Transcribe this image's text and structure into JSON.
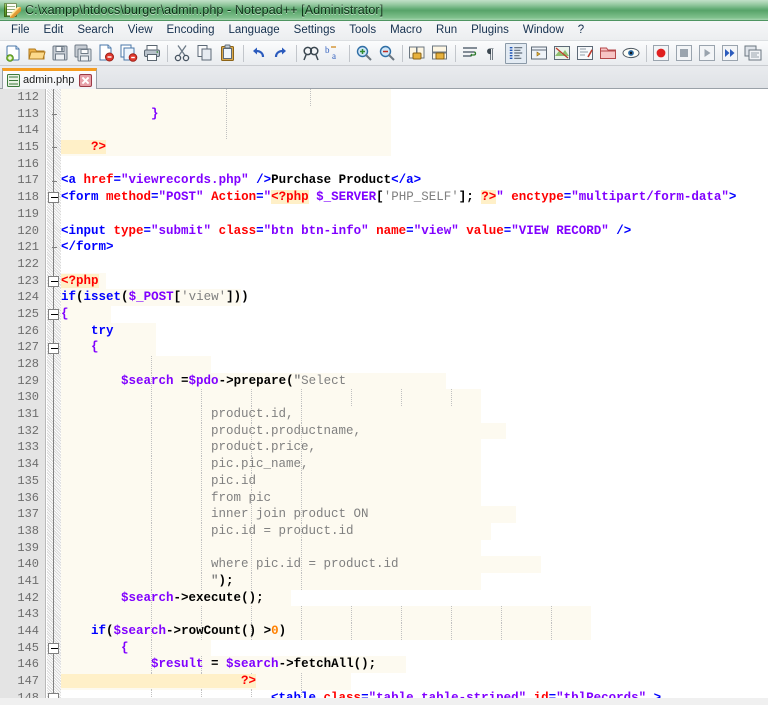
{
  "window": {
    "title": "C:\\xampp\\htdocs\\burger\\admin.php - Notepad++ [Administrator]",
    "app_icon": "notepad-plus-plus-icon"
  },
  "menubar": {
    "items": [
      {
        "label": "File"
      },
      {
        "label": "Edit"
      },
      {
        "label": "Search"
      },
      {
        "label": "View"
      },
      {
        "label": "Encoding"
      },
      {
        "label": "Language"
      },
      {
        "label": "Settings"
      },
      {
        "label": "Tools"
      },
      {
        "label": "Macro"
      },
      {
        "label": "Run"
      },
      {
        "label": "Plugins"
      },
      {
        "label": "Window"
      },
      {
        "label": "?"
      }
    ]
  },
  "toolbar": {
    "buttons": [
      {
        "name": "new-file-icon",
        "title": "New"
      },
      {
        "name": "open-file-icon",
        "title": "Open"
      },
      {
        "name": "save-icon",
        "title": "Save"
      },
      {
        "name": "save-all-icon",
        "title": "Save All"
      },
      {
        "name": "close-file-icon",
        "title": "Close"
      },
      {
        "name": "close-all-icon",
        "title": "Close All"
      },
      {
        "name": "print-icon",
        "title": "Print"
      },
      {
        "name": "separator-1",
        "title": ""
      },
      {
        "name": "cut-icon",
        "title": "Cut"
      },
      {
        "name": "copy-icon",
        "title": "Copy"
      },
      {
        "name": "paste-icon",
        "title": "Paste"
      },
      {
        "name": "separator-2",
        "title": ""
      },
      {
        "name": "undo-icon",
        "title": "Undo"
      },
      {
        "name": "redo-icon",
        "title": "Redo"
      },
      {
        "name": "separator-3",
        "title": ""
      },
      {
        "name": "find-icon",
        "title": "Find"
      },
      {
        "name": "replace-icon",
        "title": "Replace"
      },
      {
        "name": "separator-4",
        "title": ""
      },
      {
        "name": "zoom-in-icon",
        "title": "Zoom In"
      },
      {
        "name": "zoom-out-icon",
        "title": "Zoom Out"
      },
      {
        "name": "separator-5",
        "title": ""
      },
      {
        "name": "sync-vertical-scroll-icon",
        "title": "Synchronize Vertical Scrolling"
      },
      {
        "name": "sync-horizontal-scroll-icon",
        "title": "Synchronize Horizontal Scrolling"
      },
      {
        "name": "separator-6",
        "title": ""
      },
      {
        "name": "word-wrap-icon",
        "title": "Word wrap"
      },
      {
        "name": "show-all-characters-icon",
        "title": "Show All Characters"
      },
      {
        "name": "show-indent-guide-icon",
        "title": "Show Indent Guide"
      },
      {
        "name": "user-defined-dialog-icon",
        "title": "User Defined Dialogue"
      },
      {
        "name": "document-map-icon",
        "title": "Document Map"
      },
      {
        "name": "function-list-icon",
        "title": "Function List"
      },
      {
        "name": "folder-workspace-icon",
        "title": "Folder as Workspace"
      },
      {
        "name": "monitoring-icon",
        "title": "Monitoring"
      },
      {
        "name": "separator-7",
        "title": ""
      },
      {
        "name": "record-macro-icon",
        "title": "Start Recording"
      },
      {
        "name": "stop-macro-icon",
        "title": "Stop Recording"
      },
      {
        "name": "play-macro-icon",
        "title": "Playback"
      },
      {
        "name": "run-macro-multiple-icon",
        "title": "Run a Macro Multiple Times"
      },
      {
        "name": "save-macro-icon",
        "title": "Save Current Recorded Macro"
      },
      {
        "name": "separator-8",
        "title": ""
      },
      {
        "name": "run-icon",
        "title": "Run"
      }
    ]
  },
  "tabs": [
    {
      "label": "admin.php",
      "icon": "saved-document-icon",
      "close": "close-tab-icon",
      "active": true
    }
  ],
  "editor": {
    "first_line_number": 112,
    "lines": [
      {
        "n": 112,
        "php_bg": true,
        "bg_w": 330,
        "indent_guides": [
          165,
          249
        ],
        "tokens": []
      },
      {
        "n": 113,
        "php_bg": true,
        "bg_w": 330,
        "indent_guides": [
          165
        ],
        "tokens": [
          {
            "c": "t-brace",
            "s": "            }"
          }
        ]
      },
      {
        "n": 114,
        "php_bg": true,
        "bg_w": 330,
        "indent_guides": [
          165
        ],
        "tokens": []
      },
      {
        "n": 115,
        "php_bg": true,
        "bg_w": 330,
        "indent_guides": [],
        "tokens": [
          {
            "c": "t-php",
            "s": "    ?>"
          }
        ]
      },
      {
        "n": 116,
        "php_bg": false,
        "bg_w": 0,
        "indent_guides": [],
        "tokens": []
      },
      {
        "n": 117,
        "php_bg": false,
        "bg_w": 0,
        "indent_guides": [],
        "tokens": [
          {
            "c": "t-tag",
            "s": "<a "
          },
          {
            "c": "t-attr",
            "s": "href"
          },
          {
            "c": "t-tag",
            "s": "="
          },
          {
            "c": "t-val",
            "s": "\"viewrecords.php\""
          },
          {
            "c": "t-tag",
            "s": " />"
          },
          {
            "c": "t-txt",
            "s": "Purchase Product"
          },
          {
            "c": "t-tag",
            "s": "</a>"
          }
        ]
      },
      {
        "n": 118,
        "php_bg": false,
        "bg_w": 0,
        "indent_guides": [],
        "tokens": [
          {
            "c": "t-tag",
            "s": "<form "
          },
          {
            "c": "t-attr",
            "s": "method"
          },
          {
            "c": "t-tag",
            "s": "="
          },
          {
            "c": "t-val",
            "s": "\"POST\""
          },
          {
            "c": "t-tag",
            "s": " "
          },
          {
            "c": "t-attr",
            "s": "Action"
          },
          {
            "c": "t-tag",
            "s": "="
          },
          {
            "c": "t-val",
            "s": "\""
          },
          {
            "c": "t-php",
            "s": "<?php"
          },
          {
            "c": "t-op",
            "s": " "
          },
          {
            "c": "t-var",
            "s": "$_SERVER"
          },
          {
            "c": "t-op",
            "s": "["
          },
          {
            "c": "t-str",
            "s": "'PHP_SELF'"
          },
          {
            "c": "t-op",
            "s": "]; "
          },
          {
            "c": "t-php",
            "s": "?>"
          },
          {
            "c": "t-val",
            "s": "\""
          },
          {
            "c": "t-tag",
            "s": " "
          },
          {
            "c": "t-attr",
            "s": "enctype"
          },
          {
            "c": "t-tag",
            "s": "="
          },
          {
            "c": "t-val",
            "s": "\"multipart/form-data\""
          },
          {
            "c": "t-tag",
            "s": ">"
          }
        ]
      },
      {
        "n": 119,
        "php_bg": false,
        "bg_w": 0,
        "indent_guides": [],
        "tokens": []
      },
      {
        "n": 120,
        "php_bg": false,
        "bg_w": 0,
        "indent_guides": [],
        "tokens": [
          {
            "c": "t-tag",
            "s": "<input "
          },
          {
            "c": "t-attr",
            "s": "type"
          },
          {
            "c": "t-tag",
            "s": "="
          },
          {
            "c": "t-val",
            "s": "\"submit\""
          },
          {
            "c": "t-tag",
            "s": " "
          },
          {
            "c": "t-attr",
            "s": "class"
          },
          {
            "c": "t-tag",
            "s": "="
          },
          {
            "c": "t-val",
            "s": "\"btn btn-info\""
          },
          {
            "c": "t-tag",
            "s": " "
          },
          {
            "c": "t-attr",
            "s": "name"
          },
          {
            "c": "t-tag",
            "s": "="
          },
          {
            "c": "t-val",
            "s": "\"view\""
          },
          {
            "c": "t-tag",
            "s": " "
          },
          {
            "c": "t-attr",
            "s": "value"
          },
          {
            "c": "t-tag",
            "s": "="
          },
          {
            "c": "t-val",
            "s": "\"VIEW RECORD\""
          },
          {
            "c": "t-tag",
            "s": " />"
          }
        ]
      },
      {
        "n": 121,
        "php_bg": false,
        "bg_w": 0,
        "indent_guides": [],
        "tokens": [
          {
            "c": "t-tag",
            "s": "</form>"
          }
        ]
      },
      {
        "n": 122,
        "php_bg": false,
        "bg_w": 0,
        "indent_guides": [],
        "tokens": []
      },
      {
        "n": 123,
        "php_bg": true,
        "bg_w": 45,
        "indent_guides": [],
        "tokens": [
          {
            "c": "t-php",
            "s": "<?php"
          }
        ]
      },
      {
        "n": 124,
        "php_bg": true,
        "bg_w": 180,
        "indent_guides": [],
        "tokens": [
          {
            "c": "t-kw",
            "s": "if"
          },
          {
            "c": "t-op",
            "s": "("
          },
          {
            "c": "t-kw",
            "s": "isset"
          },
          {
            "c": "t-op",
            "s": "("
          },
          {
            "c": "t-var",
            "s": "$_POST"
          },
          {
            "c": "t-op",
            "s": "["
          },
          {
            "c": "t-str",
            "s": "'view'"
          },
          {
            "c": "t-op",
            "s": "]))"
          }
        ]
      },
      {
        "n": 125,
        "php_bg": true,
        "bg_w": 50,
        "indent_guides": [],
        "tokens": [
          {
            "c": "t-brace",
            "s": "{"
          }
        ]
      },
      {
        "n": 126,
        "php_bg": true,
        "bg_w": 95,
        "indent_guides": [],
        "tokens": [
          {
            "c": "t-kw",
            "s": "    try"
          }
        ]
      },
      {
        "n": 127,
        "php_bg": true,
        "bg_w": 95,
        "indent_guides": [],
        "tokens": [
          {
            "c": "t-brace",
            "s": "    {"
          }
        ]
      },
      {
        "n": 128,
        "php_bg": true,
        "bg_w": 150,
        "indent_guides": [
          90
        ],
        "tokens": []
      },
      {
        "n": 129,
        "php_bg": true,
        "bg_w": 385,
        "indent_guides": [
          90
        ],
        "tokens": [
          {
            "c": "t-var",
            "s": "        $search "
          },
          {
            "c": "t-op",
            "s": "="
          },
          {
            "c": "t-var",
            "s": "$pdo"
          },
          {
            "c": "t-op",
            "s": "->"
          },
          {
            "c": "t-def",
            "s": "prepare"
          },
          {
            "c": "t-op",
            "s": "("
          },
          {
            "c": "t-strq",
            "s": "\""
          },
          {
            "c": "t-str",
            "s": "Select"
          }
        ]
      },
      {
        "n": 130,
        "php_bg": true,
        "bg_w": 420,
        "indent_guides": [
          90,
          140,
          190,
          240,
          290,
          340,
          390
        ],
        "tokens": []
      },
      {
        "n": 131,
        "php_bg": true,
        "bg_w": 420,
        "indent_guides": [
          90,
          140,
          190,
          240
        ],
        "tokens": [
          {
            "c": "t-str",
            "s": "                    product.id,"
          }
        ]
      },
      {
        "n": 132,
        "php_bg": true,
        "bg_w": 445,
        "indent_guides": [
          90,
          140,
          190,
          240
        ],
        "tokens": [
          {
            "c": "t-str",
            "s": "                    product.productname,"
          }
        ]
      },
      {
        "n": 133,
        "php_bg": true,
        "bg_w": 420,
        "indent_guides": [
          90,
          140,
          190,
          240
        ],
        "tokens": [
          {
            "c": "t-str",
            "s": "                    product.price,"
          }
        ]
      },
      {
        "n": 134,
        "php_bg": true,
        "bg_w": 420,
        "indent_guides": [
          90,
          140,
          190,
          240
        ],
        "tokens": [
          {
            "c": "t-str",
            "s": "                    pic.pic_name,"
          }
        ]
      },
      {
        "n": 135,
        "php_bg": true,
        "bg_w": 420,
        "indent_guides": [
          90,
          140,
          190,
          240
        ],
        "tokens": [
          {
            "c": "t-str",
            "s": "                    pic.id"
          }
        ]
      },
      {
        "n": 136,
        "php_bg": true,
        "bg_w": 420,
        "indent_guides": [
          90,
          140,
          190,
          240
        ],
        "tokens": [
          {
            "c": "t-str",
            "s": "                    from pic"
          }
        ]
      },
      {
        "n": 137,
        "php_bg": true,
        "bg_w": 455,
        "indent_guides": [
          90,
          140,
          190,
          240
        ],
        "tokens": [
          {
            "c": "t-str",
            "s": "                    inner join product ON"
          }
        ]
      },
      {
        "n": 138,
        "php_bg": true,
        "bg_w": 430,
        "indent_guides": [
          90,
          140,
          190,
          240
        ],
        "tokens": [
          {
            "c": "t-str",
            "s": "                    pic.id = product.id"
          }
        ]
      },
      {
        "n": 139,
        "php_bg": true,
        "bg_w": 420,
        "indent_guides": [
          90,
          140,
          190,
          240
        ],
        "tokens": []
      },
      {
        "n": 140,
        "php_bg": true,
        "bg_w": 480,
        "indent_guides": [
          90,
          140,
          190,
          240
        ],
        "tokens": [
          {
            "c": "t-str",
            "s": "                    where pic.id = product.id"
          }
        ]
      },
      {
        "n": 141,
        "php_bg": true,
        "bg_w": 420,
        "indent_guides": [
          90,
          140,
          190,
          240
        ],
        "tokens": [
          {
            "c": "t-strq",
            "s": "                    \""
          },
          {
            "c": "t-op",
            "s": ");"
          }
        ]
      },
      {
        "n": 142,
        "php_bg": true,
        "bg_w": 230,
        "indent_guides": [
          90
        ],
        "tokens": [
          {
            "c": "t-var",
            "s": "        $search"
          },
          {
            "c": "t-op",
            "s": "->"
          },
          {
            "c": "t-def",
            "s": "execute"
          },
          {
            "c": "t-op",
            "s": "();"
          }
        ]
      },
      {
        "n": 143,
        "php_bg": true,
        "bg_w": 530,
        "indent_guides": [
          90,
          140,
          190,
          240,
          290,
          340,
          390,
          440,
          490
        ],
        "tokens": []
      },
      {
        "n": 144,
        "php_bg": true,
        "bg_w": 530,
        "indent_guides": [
          90,
          140,
          190,
          240,
          290,
          340,
          390,
          440,
          490
        ],
        "tokens": [
          {
            "c": "t-kw",
            "s": "    if"
          },
          {
            "c": "t-op",
            "s": "("
          },
          {
            "c": "t-var",
            "s": "$search"
          },
          {
            "c": "t-op",
            "s": "->"
          },
          {
            "c": "t-def",
            "s": "rowCount"
          },
          {
            "c": "t-op",
            "s": "() >"
          },
          {
            "c": "t-num",
            "s": "0"
          },
          {
            "c": "t-op",
            "s": ")"
          }
        ]
      },
      {
        "n": 145,
        "php_bg": true,
        "bg_w": 150,
        "indent_guides": [
          90
        ],
        "tokens": [
          {
            "c": "t-brace",
            "s": "        {"
          }
        ]
      },
      {
        "n": 146,
        "php_bg": true,
        "bg_w": 345,
        "indent_guides": [
          90,
          140
        ],
        "tokens": [
          {
            "c": "t-var",
            "s": "            $result "
          },
          {
            "c": "t-op",
            "s": "= "
          },
          {
            "c": "t-var",
            "s": "$search"
          },
          {
            "c": "t-op",
            "s": "->"
          },
          {
            "c": "t-def",
            "s": "fetchAll"
          },
          {
            "c": "t-op",
            "s": "();"
          }
        ]
      },
      {
        "n": 147,
        "php_bg": true,
        "bg_w": 290,
        "indent_guides": [
          90,
          140,
          190,
          240
        ],
        "tokens": [
          {
            "c": "t-php",
            "s": "                        ?>"
          }
        ]
      },
      {
        "n": 148,
        "php_bg": false,
        "bg_w": 0,
        "indent_guides": [
          90,
          140,
          190,
          240
        ],
        "tokens": [
          {
            "c": "t-tag",
            "s": "                            <table "
          },
          {
            "c": "t-attr",
            "s": "class"
          },
          {
            "c": "t-tag",
            "s": "="
          },
          {
            "c": "t-val",
            "s": "\"table table-striped\""
          },
          {
            "c": "t-tag",
            "s": " "
          },
          {
            "c": "t-attr",
            "s": "id"
          },
          {
            "c": "t-tag",
            "s": "="
          },
          {
            "c": "t-val",
            "s": "\"tblRecords\""
          },
          {
            "c": "t-tag",
            "s": " >"
          }
        ]
      }
    ],
    "fold_boxes": [
      123,
      125,
      127,
      145,
      148,
      118
    ],
    "fold_dashes": [
      113,
      115,
      117,
      121
    ]
  },
  "colors": {
    "title_bar": "#5fa971",
    "tab_accent": "#f59d21",
    "php_block_bg": "#fdfaf0",
    "php_delim_bg": "#fff0c8",
    "gutter_bg": "#e4e4e4",
    "tag": "#0000ff",
    "attribute": "#ff0000",
    "value": "#8000ff",
    "string": "#808080",
    "number": "#ff8000"
  }
}
